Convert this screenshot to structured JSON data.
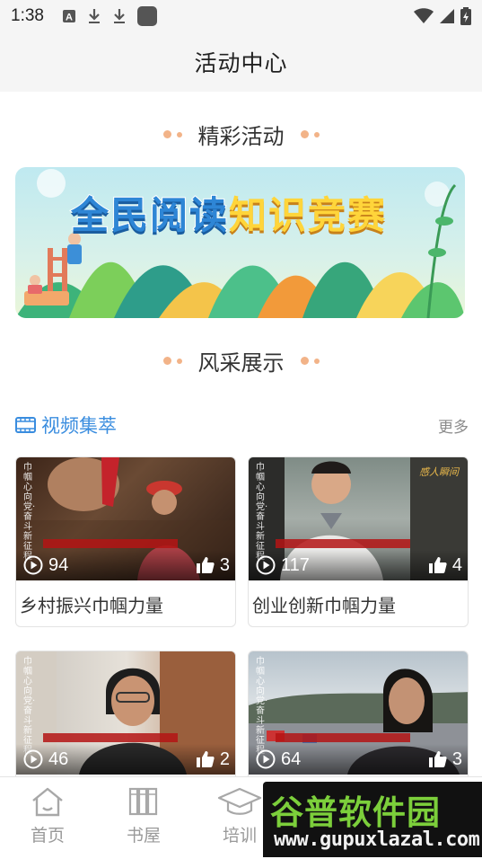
{
  "status_bar": {
    "time": "1:38"
  },
  "header": {
    "title": "活动中心"
  },
  "sections": {
    "activities": {
      "title": "精彩活动"
    },
    "showcase": {
      "title": "风采展示"
    }
  },
  "banner": {
    "text_blue": "全民阅读",
    "text_yellow": "知识竞赛"
  },
  "videos": {
    "title": "视频集萃",
    "more_label": "更多",
    "items": [
      {
        "title": "乡村振兴巾帼力量",
        "views": "94",
        "likes": "3"
      },
      {
        "title": "创业创新巾帼力量",
        "views": "117",
        "likes": "4"
      },
      {
        "title": "",
        "views": "46",
        "likes": "2"
      },
      {
        "title": "",
        "views": "64",
        "likes": "3"
      }
    ]
  },
  "bottom_nav": {
    "items": [
      {
        "label": "首页",
        "icon": "home-icon"
      },
      {
        "label": "书屋",
        "icon": "books-icon"
      },
      {
        "label": "培训",
        "icon": "graduation-cap-icon"
      }
    ]
  },
  "watermark": {
    "brand": "谷普软件园",
    "url": "www.gupuxlazal.com"
  },
  "colors": {
    "accent": "#3a8ddf",
    "dots": "#f2b388",
    "nav_inactive": "#999999"
  }
}
